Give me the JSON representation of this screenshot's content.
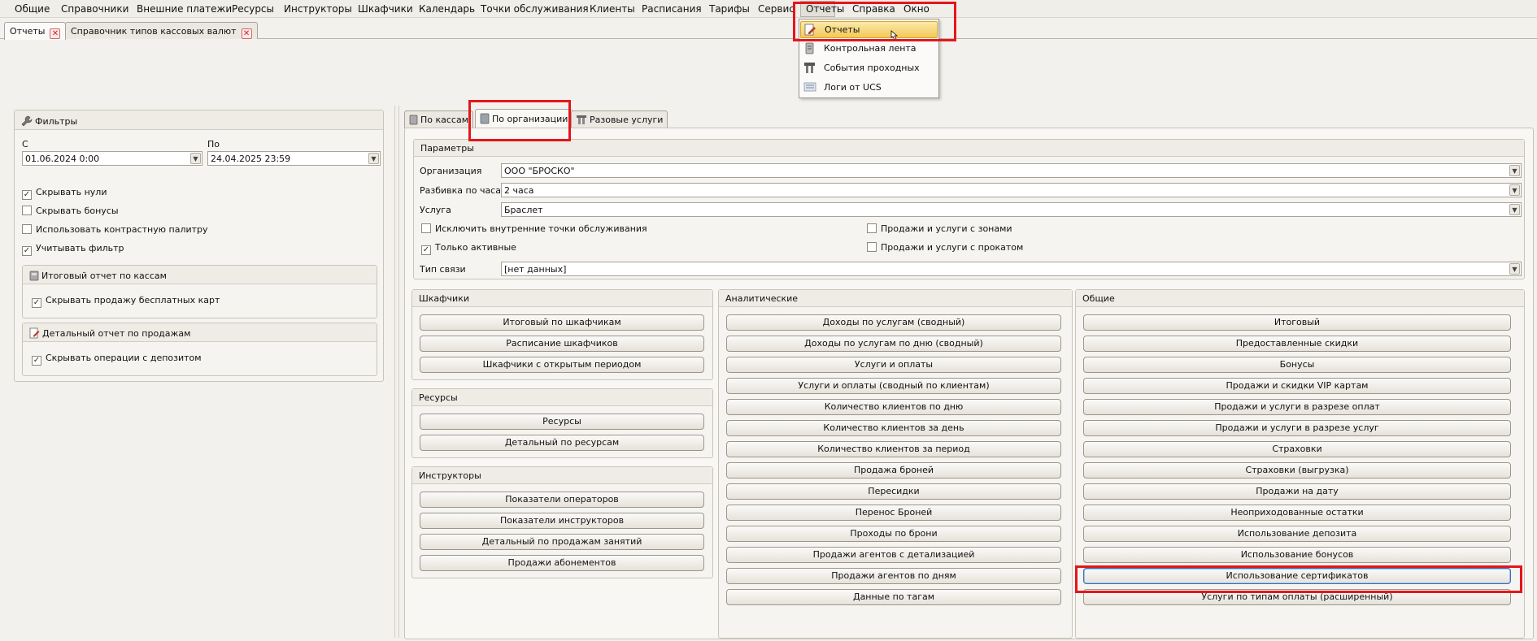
{
  "menubar": {
    "items": [
      "Общие",
      "Справочники",
      "Внешние платежи",
      "Ресурсы",
      "Инструкторы",
      "Шкафчики",
      "Календарь",
      "Точки обслуживания",
      "Клиенты",
      "Расписания",
      "Тарифы",
      "Сервис",
      "Отчеты",
      "Справка",
      "Окно"
    ]
  },
  "reports_menu": {
    "items": [
      {
        "label": "Отчеты",
        "icon": "report-edit-icon"
      },
      {
        "label": "Контрольная лента",
        "icon": "tape-icon"
      },
      {
        "label": "События проходных",
        "icon": "turnstile-icon"
      },
      {
        "label": "Логи от UCS",
        "icon": "log-icon"
      }
    ]
  },
  "doc_tabs": [
    "Отчеты",
    "Справочник типов кассовых валют"
  ],
  "filters": {
    "title": "Фильтры",
    "from_label": "С",
    "from_value": "01.06.2024 0:00",
    "to_label": "По",
    "to_value": "24.04.2025 23:59",
    "checks": [
      {
        "label": "Скрывать нули",
        "checked": true
      },
      {
        "label": "Скрывать бонусы",
        "checked": false
      },
      {
        "label": "Использовать контрастную палитру",
        "checked": false
      },
      {
        "label": "Учитывать фильтр",
        "checked": true
      }
    ],
    "group1": {
      "title": "Итоговый отчет по кассам",
      "check": "Скрывать продажу бесплатных карт",
      "checked": true
    },
    "group2": {
      "title": "Детальный отчет по продажам",
      "check": "Скрывать операции с депозитом",
      "checked": true
    }
  },
  "report_tabs": [
    "По кассам",
    "По организации",
    "Разовые услуги"
  ],
  "params": {
    "title": "Параметры",
    "org_label": "Организация",
    "org_value": "ООО \"БРОСКО\"",
    "hours_label": "Разбивка по часам",
    "hours_value": "2 часа",
    "service_label": "Услуга",
    "service_value": "Браслет",
    "excl_internal": "Исключить внутренние точки обслуживания",
    "only_active": "Только активные",
    "with_zones": "Продажи и услуги с зонами",
    "with_rental": "Продажи и услуги с прокатом",
    "link_label": "Тип связи",
    "link_value": "[нет данных]"
  },
  "groups": {
    "lockers": {
      "title": "Шкафчики",
      "buttons": [
        "Итоговый по шкафчикам",
        "Расписание шкафчиков",
        "Шкафчики с открытым периодом"
      ]
    },
    "resources": {
      "title": "Ресурсы",
      "buttons": [
        "Ресурсы",
        "Детальный по ресурсам"
      ]
    },
    "instructors": {
      "title": "Инструкторы",
      "buttons": [
        "Показатели операторов",
        "Показатели инструкторов",
        "Детальный по продажам занятий",
        "Продажи абонементов"
      ]
    },
    "analytics": {
      "title": "Аналитические",
      "buttons": [
        "Доходы по услугам (сводный)",
        "Доходы по услугам по дню (сводный)",
        "Услуги и оплаты",
        "Услуги и оплаты (сводный по клиентам)",
        "Количество клиентов по дню",
        "Количество клиентов за день",
        "Количество клиентов за период",
        "Продажа броней",
        "Пересидки",
        "Перенос Броней",
        "Проходы по брони",
        "Продажи агентов с детализацией",
        "Продажи агентов по дням",
        "Данные по тагам"
      ]
    },
    "general": {
      "title": "Общие",
      "buttons": [
        "Итоговый",
        "Предоставленные скидки",
        "Бонусы",
        "Продажи и скидки VIP картам",
        "Продажи и услуги в разрезе оплат",
        "Продажи и услуги в разрезе услуг",
        "Страховки",
        "Страховки (выгрузка)",
        "Продажи на дату",
        "Неоприходованные остатки",
        "Использование депозита",
        "Использование бонусов",
        "Использование сертификатов",
        "Услуги по типам оплаты (расширенный)"
      ]
    }
  },
  "colors": {
    "highlight": "#e4161b",
    "menu_selected": "#f3c95a"
  }
}
